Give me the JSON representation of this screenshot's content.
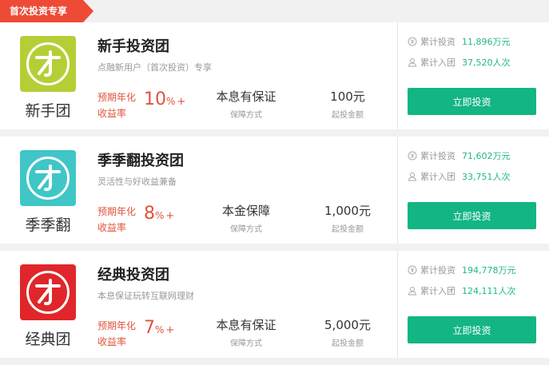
{
  "ribbon": "首次投资专享",
  "colors": {
    "green_btn": "#13b584",
    "red_rate": "#e0533c",
    "stat_green": "#21b884"
  },
  "products": [
    {
      "logo_color": "#b4cf36",
      "logo_name": "新手团",
      "title": "新手投资团",
      "subtitle": "点融新用户（首次投资）专享",
      "rate_label_1": "预期年化",
      "rate_label_2": "收益率",
      "rate": "10",
      "pct": "%",
      "plus": "+",
      "guarantee": "本息有保证",
      "guarantee_label": "保障方式",
      "min_amount": "100元",
      "min_amount_label": "起投金额",
      "total_invest_label": "累计投资",
      "total_invest": "11,896万元",
      "total_join_label": "累计入团",
      "total_join": "37,520人次",
      "button": "立即投资"
    },
    {
      "logo_color": "#40c6c6",
      "logo_name": "季季翻",
      "title": "季季翻投资团",
      "subtitle": "灵活性与好收益兼备",
      "rate_label_1": "预期年化",
      "rate_label_2": "收益率",
      "rate": "8",
      "pct": "%",
      "plus": "+",
      "guarantee": "本金保障",
      "guarantee_label": "保障方式",
      "min_amount": "1,000元",
      "min_amount_label": "起投金额",
      "total_invest_label": "累计投资",
      "total_invest": "71,602万元",
      "total_join_label": "累计入团",
      "total_join": "33,751人次",
      "button": "立即投资"
    },
    {
      "logo_color": "#e0262a",
      "logo_name": "经典团",
      "title": "经典投资团",
      "subtitle": "本息保证玩转互联网理财",
      "rate_label_1": "预期年化",
      "rate_label_2": "收益率",
      "rate": "7",
      "pct": "%",
      "plus": "+",
      "guarantee": "本息有保证",
      "guarantee_label": "保障方式",
      "min_amount": "5,000元",
      "min_amount_label": "起投金额",
      "total_invest_label": "累计投资",
      "total_invest": "194,778万元",
      "total_join_label": "累计入团",
      "total_join": "124,111人次",
      "button": "立即投资"
    }
  ]
}
